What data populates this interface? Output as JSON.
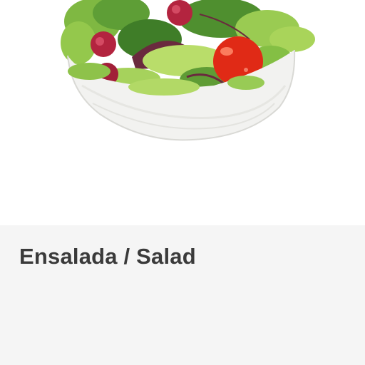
{
  "product": {
    "title": "Ensalada / Salad",
    "image": {
      "icon": "salad-bowl-image",
      "colors": {
        "bowl": "#f2f2f0",
        "leaf_light": "#a9d45a",
        "leaf_dark": "#4f8f2f",
        "leaf_purple": "#6a2a3e",
        "tomato": "#e02a16",
        "cranberry": "#b3243f"
      }
    },
    "panel_background": "#f5f5f5",
    "title_color": "#3a3a3a"
  }
}
